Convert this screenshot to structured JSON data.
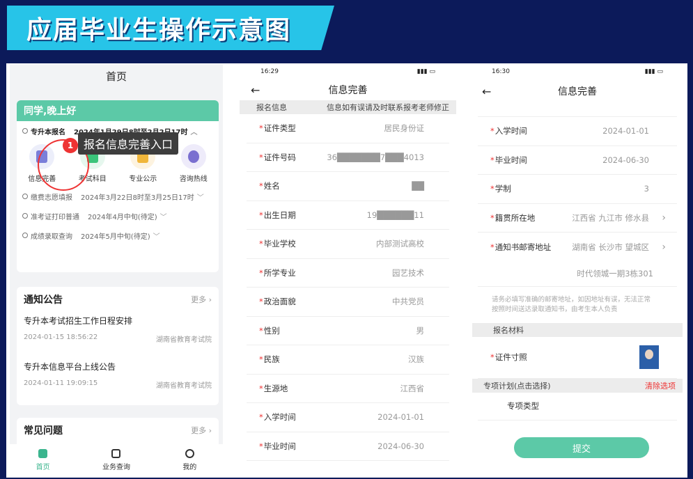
{
  "banner": {
    "title": "应届毕业生操作示意图"
  },
  "screen1": {
    "title": "首页",
    "greeting": "同学,晚上好",
    "steps": [
      {
        "name": "专升本报名",
        "time": "2024年1月29日8时至2月2日17时"
      },
      {
        "name": "缴费志愿填报",
        "time": "2024年3月22日8时至3月25日17时"
      },
      {
        "name": "准考证打印普通",
        "time": "2024年4月中旬(待定)"
      },
      {
        "name": "成绩录取查询",
        "time": "2024年5月中旬(待定)"
      }
    ],
    "badge": "1",
    "tooltip": "报名信息完善入口",
    "icons": [
      {
        "label": "信息完善",
        "color": "#7a7ed9"
      },
      {
        "label": "考试科目",
        "color": "#3bc47a"
      },
      {
        "label": "专业公示",
        "color": "#f0b63a"
      },
      {
        "label": "咨询热线",
        "color": "#7a6fd0"
      }
    ],
    "notice_title": "通知公告",
    "more": "更多",
    "news": [
      {
        "title": "专升本考试招生工作日程安排",
        "date": "2024-01-15 18:56:22",
        "source": "湖南省教育考试院"
      },
      {
        "title": "专升本信息平台上线公告",
        "date": "2024-01-11 19:09:15",
        "source": "湖南省教育考试院"
      }
    ],
    "faq_title": "常见问题",
    "tabs": [
      "首页",
      "业务查询",
      "我的"
    ]
  },
  "screen2": {
    "time": "16:29",
    "title": "信息完善",
    "section": "报名信息",
    "section_note": "信息如有误请及时联系报考老师修正",
    "fields": [
      {
        "label": "证件类型",
        "value": "居民身份证"
      },
      {
        "label": "证件号码",
        "value": "36███████7███4013"
      },
      {
        "label": "姓名",
        "value": "██"
      },
      {
        "label": "出生日期",
        "value": "19██████11"
      },
      {
        "label": "毕业学校",
        "value": "内部测试高校"
      },
      {
        "label": "所学专业",
        "value": "园艺技术"
      },
      {
        "label": "政治面貌",
        "value": "中共党员"
      },
      {
        "label": "性别",
        "value": "男"
      },
      {
        "label": "民族",
        "value": "汉族"
      },
      {
        "label": "生源地",
        "value": "江西省"
      },
      {
        "label": "入学时间",
        "value": "2024-01-01"
      },
      {
        "label": "毕业时间",
        "value": "2024-06-30"
      }
    ]
  },
  "screen3": {
    "time": "16:30",
    "title": "信息完善",
    "fields": [
      {
        "label": "入学时间",
        "value": "2024-01-01"
      },
      {
        "label": "毕业时间",
        "value": "2024-06-30"
      },
      {
        "label": "学制",
        "value": "3"
      },
      {
        "label": "籍贯所在地",
        "value": "江西省  九江市  修水县"
      },
      {
        "label": "通知书邮寄地址",
        "value": "湖南省  长沙市  望城区"
      }
    ],
    "address_detail": "时代领城一期3栋301",
    "note": "请务必填写准确的邮寄地址，如因地址有误，无法正常按照时间送达录取通知书，由考生本人负责",
    "materials_title": "报名材料",
    "photo_label": "证件寸照",
    "special_title": "专项计划(点击选择)",
    "clear_label": "清除选项",
    "special_type": "专项类型",
    "submit": "提交"
  }
}
